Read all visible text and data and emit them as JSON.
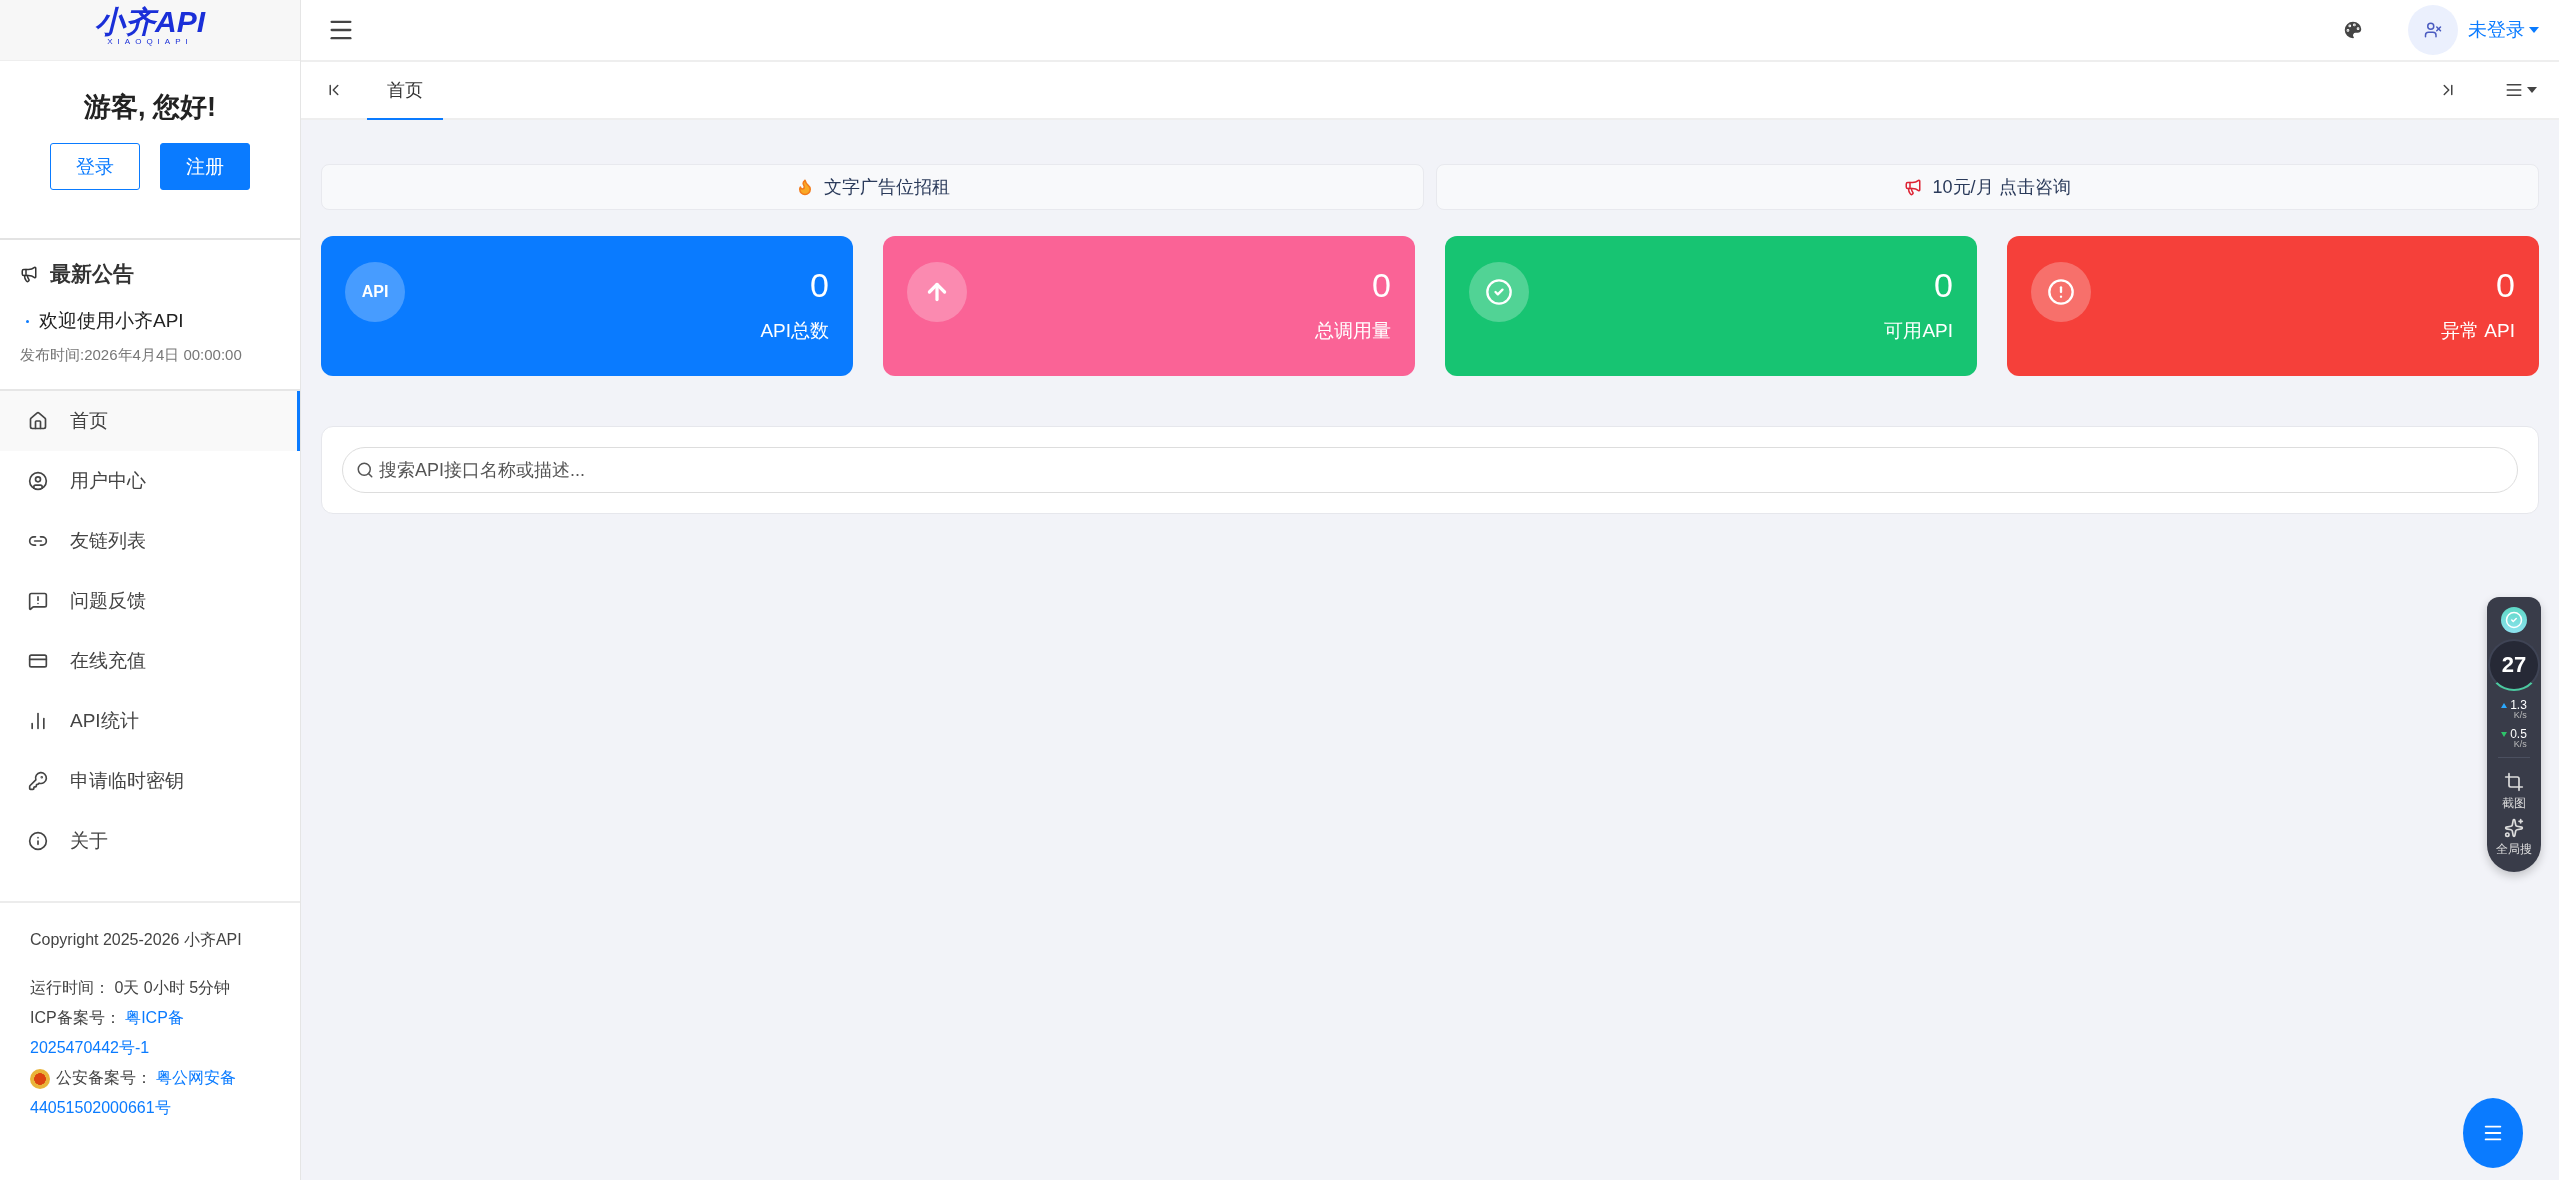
{
  "logo": {
    "title": "小齐API",
    "subtitle": "XIAOQIAPI"
  },
  "greeting": "游客, 您好!",
  "auth_buttons": [
    {
      "label": "登录",
      "kind": "outline"
    },
    {
      "label": "注册",
      "kind": "solid"
    }
  ],
  "announcements": {
    "title": "最新公告",
    "items": [
      {
        "text": "欢迎使用小齐API",
        "date": "发布时间:2026年4月4日 00:00:00"
      }
    ]
  },
  "nav": [
    {
      "label": "首页",
      "kind": "home",
      "selected": true
    },
    {
      "label": "用户中心",
      "kind": "user",
      "selected": false
    },
    {
      "label": "友链列表",
      "kind": "link",
      "selected": false
    },
    {
      "label": "问题反馈",
      "kind": "feedback",
      "selected": false
    },
    {
      "label": "在线充值",
      "kind": "card",
      "selected": false
    },
    {
      "label": "API统计",
      "kind": "chart",
      "selected": false
    },
    {
      "label": "申请临时密钥",
      "kind": "key",
      "selected": false
    },
    {
      "label": "关于",
      "kind": "info",
      "selected": false
    }
  ],
  "footer": {
    "copyright": "Copyright 2025-2026 小齐API",
    "runtime_label": "运行时间：",
    "runtime": "0天 0小时 5分钟",
    "icp_label": "ICP备案号：",
    "icp_link_lines": [
      "粤ICP备",
      "2025470442号-1"
    ],
    "police_label": "公安备案号：",
    "police_link_lines": [
      "粤公网安备",
      "44051502000661号"
    ]
  },
  "header": {
    "user": "未登录"
  },
  "tabs": [
    {
      "label": "首页",
      "selected": true
    }
  ],
  "ads": [
    {
      "kind": "fire",
      "text": "文字广告位招租"
    },
    {
      "kind": "megaphone",
      "text": "10元/月 点击咨询"
    }
  ],
  "stats": [
    {
      "kind": "badge",
      "badge": "API",
      "value": "0",
      "label": "API总数",
      "color": "#0a7bff"
    },
    {
      "kind": "up",
      "value": "0",
      "label": "总调用量",
      "color": "#fa6396"
    },
    {
      "kind": "check",
      "value": "0",
      "label": "可用API",
      "color": "#17c472"
    },
    {
      "kind": "alert",
      "value": "0",
      "label": "异常 API",
      "color": "#f5403a"
    }
  ],
  "search": {
    "placeholder": "搜索API接口名称或描述..."
  },
  "widget": {
    "score": "27",
    "up": "1.3",
    "up_unit": "K/s",
    "down": "0.5",
    "down_unit": "K/s",
    "tools": [
      {
        "kind": "crop",
        "label": "截图"
      },
      {
        "kind": "search",
        "label": "全局搜"
      }
    ]
  }
}
